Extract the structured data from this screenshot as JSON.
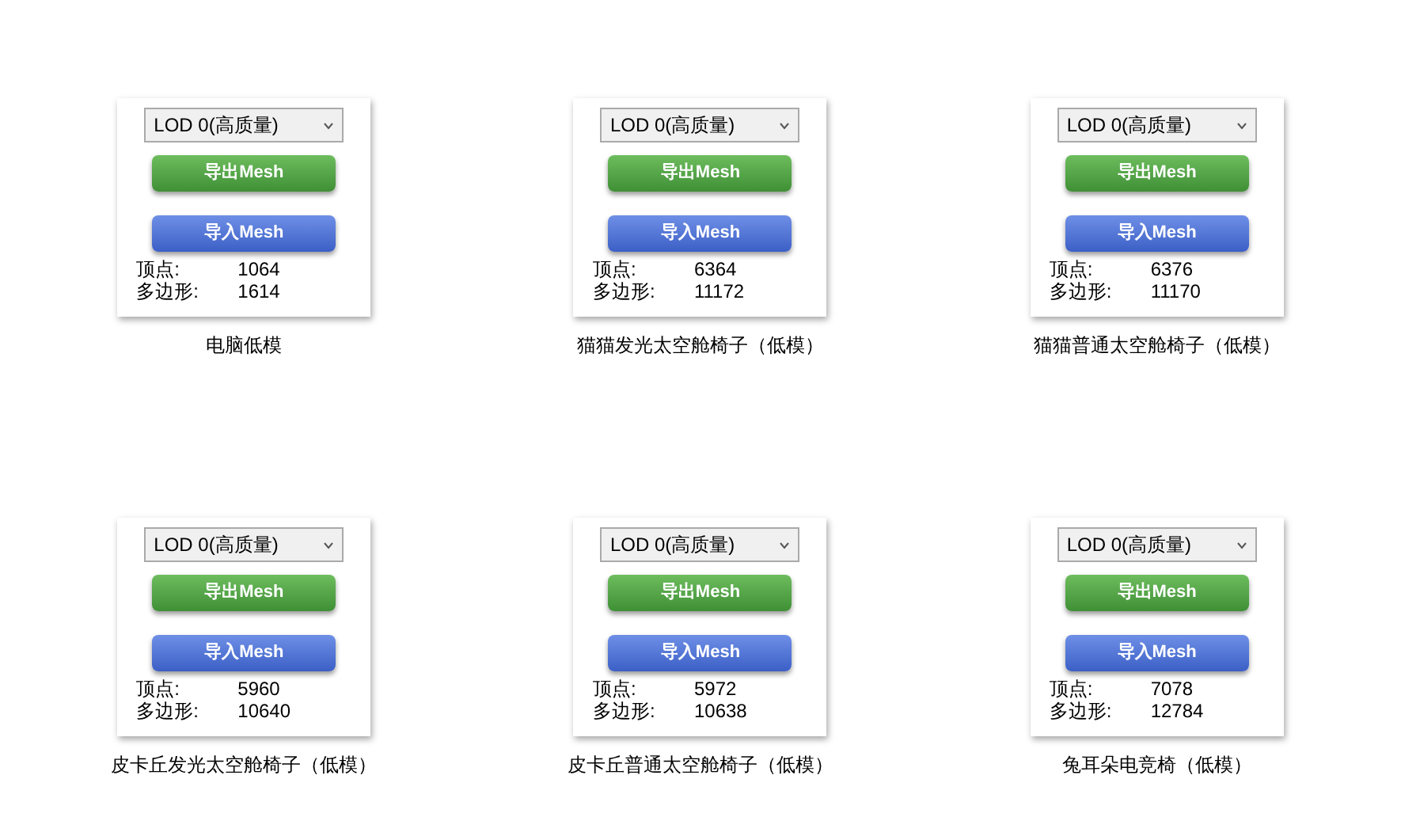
{
  "items": [
    {
      "caption": "电脑低模",
      "lod": "LOD 0(高质量)",
      "export_button": "导出Mesh",
      "import_button": "导入Mesh",
      "vertices_label": "顶点:",
      "vertices": "1064",
      "polygons_label": "多边形:",
      "polygons": "1614"
    },
    {
      "caption": "猫猫发光太空舱椅子（低模）",
      "lod": "LOD 0(高质量)",
      "export_button": "导出Mesh",
      "import_button": "导入Mesh",
      "vertices_label": "顶点:",
      "vertices": "6364",
      "polygons_label": "多边形:",
      "polygons": "11172"
    },
    {
      "caption": "猫猫普通太空舱椅子（低模）",
      "lod": "LOD 0(高质量)",
      "export_button": "导出Mesh",
      "import_button": "导入Mesh",
      "vertices_label": "顶点:",
      "vertices": "6376",
      "polygons_label": "多边形:",
      "polygons": "11170"
    },
    {
      "caption": "皮卡丘发光太空舱椅子（低模）",
      "lod": "LOD 0(高质量)",
      "export_button": "导出Mesh",
      "import_button": "导入Mesh",
      "vertices_label": "顶点:",
      "vertices": "5960",
      "polygons_label": "多边形:",
      "polygons": "10640"
    },
    {
      "caption": "皮卡丘普通太空舱椅子（低模）",
      "lod": "LOD 0(高质量)",
      "export_button": "导出Mesh",
      "import_button": "导入Mesh",
      "vertices_label": "顶点:",
      "vertices": "5972",
      "polygons_label": "多边形:",
      "polygons": "10638"
    },
    {
      "caption": "兔耳朵电竞椅（低模）",
      "lod": "LOD 0(高质量)",
      "export_button": "导出Mesh",
      "import_button": "导入Mesh",
      "vertices_label": "顶点:",
      "vertices": "7078",
      "polygons_label": "多边形:",
      "polygons": "12784"
    }
  ]
}
